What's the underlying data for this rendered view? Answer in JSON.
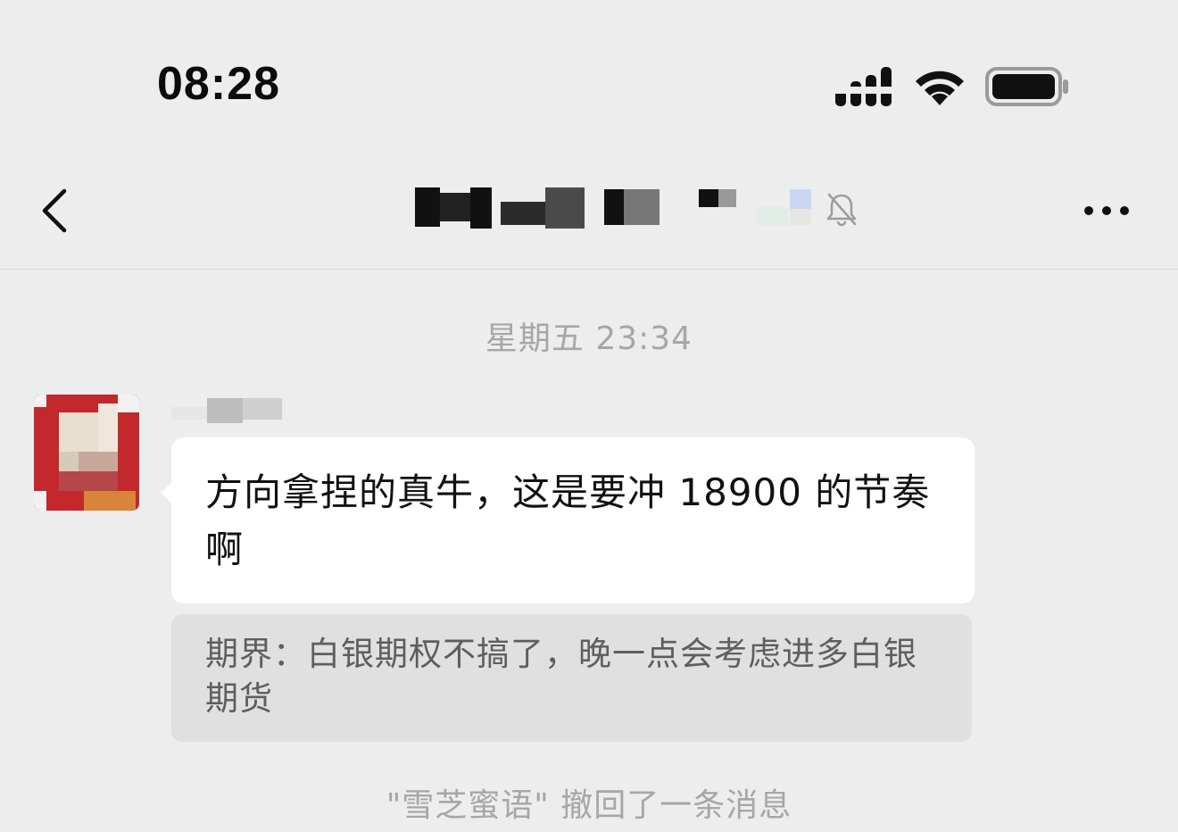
{
  "status_bar": {
    "time": "08:28",
    "signal_icon": "cellular-signal-icon",
    "wifi_icon": "wifi-icon",
    "battery_icon": "battery-icon"
  },
  "nav_bar": {
    "back_icon": "chevron-left-icon",
    "title": "",
    "mute_icon": "bell-slash-icon",
    "more_icon": "more-dots-icon"
  },
  "chat": {
    "timestamp": "星期五 23:34",
    "message": {
      "sender": "",
      "text": "方向拿捏的真牛，这是要冲 18900 的节奏啊",
      "quote": "期界：白银期权不搞了，晚一点会考虑进多白银期货"
    },
    "recall_notice": "\"雪芝蜜语\" 撤回了一条消息"
  },
  "colors": {
    "background": "#ededed",
    "bubble": "#ffffff",
    "quote_bg": "#e0e0e0",
    "muted_text": "#a6a6a6"
  }
}
